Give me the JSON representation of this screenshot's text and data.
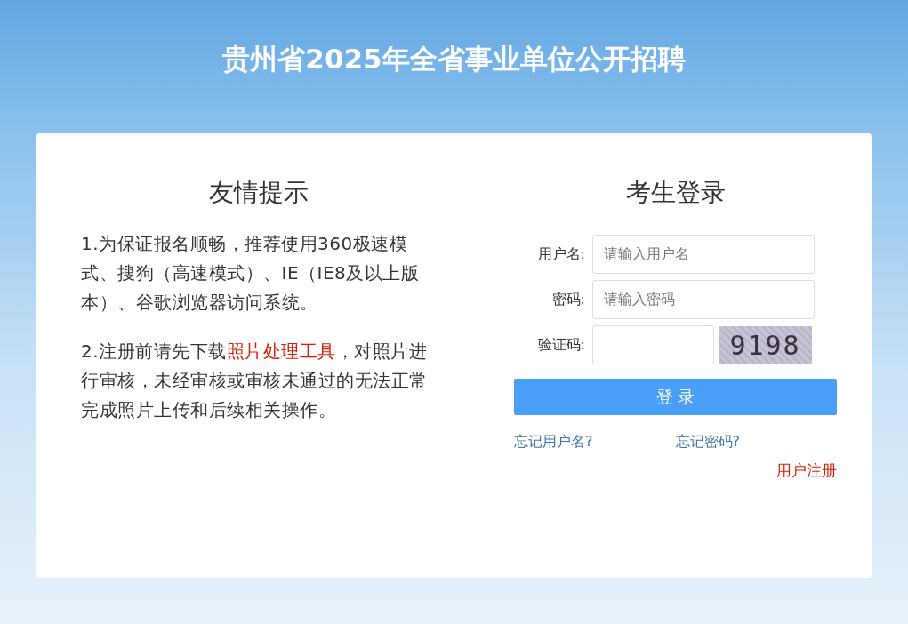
{
  "header": {
    "title": "贵州省2025年全省事业单位公开招聘"
  },
  "notice": {
    "title": "友情提示",
    "paragraphs": [
      {
        "parts": [
          {
            "text": "1.为保证报名顺畅，推荐使用360极速模式、搜狗（高速模式）、IE（IE8及以上版本）、谷歌浏览器访问系统。",
            "kind": "text"
          }
        ]
      },
      {
        "parts": [
          {
            "text": "2.注册前请先下载",
            "kind": "text"
          },
          {
            "text": "照片处理工具",
            "kind": "link"
          },
          {
            "text": "，对照片进行审核，未经审核或审核未通过的无法正常完成照片上传和后续相关操作。",
            "kind": "text"
          }
        ]
      }
    ]
  },
  "login": {
    "title": "考生登录",
    "fields": [
      {
        "label": "用户名:",
        "placeholder": "请输入用户名",
        "kind": "text"
      },
      {
        "label": "密码:",
        "placeholder": "请输入密码",
        "kind": "password"
      },
      {
        "label": "验证码:",
        "kind": "captcha",
        "captcha": "9198"
      }
    ],
    "button": "登 录",
    "links": [
      "忘记用户名?",
      "忘记密码?"
    ],
    "register": "用户注册"
  }
}
